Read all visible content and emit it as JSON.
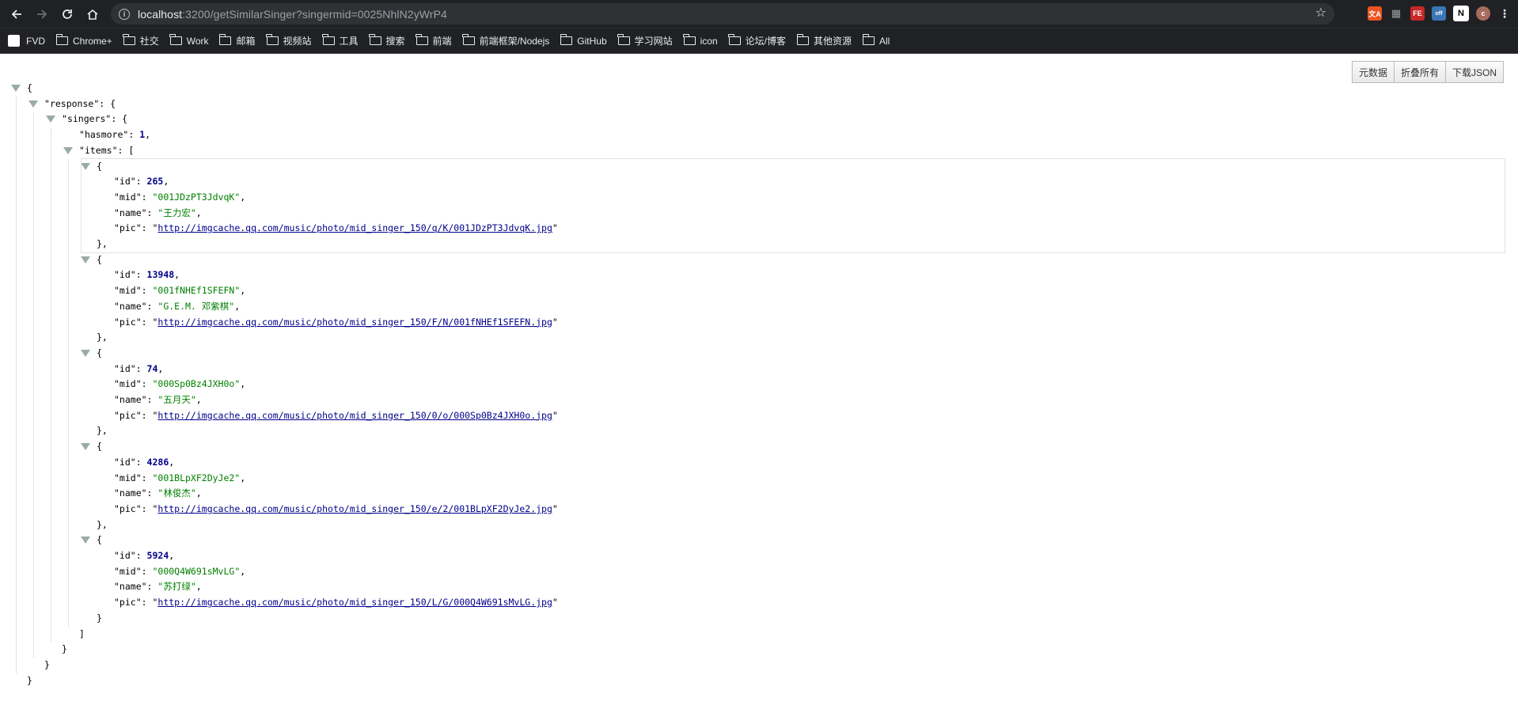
{
  "browser": {
    "url_host": "localhost",
    "url_rest": ":3200/getSimilarSinger?singermid=0025NhlN2yWrP4",
    "bookmarks": [
      "FVD",
      "Chrome+",
      "社交",
      "Work",
      "邮箱",
      "视频站",
      "工具",
      "搜索",
      "前端",
      "前端框架/Nodejs",
      "GitHub",
      "学习网站",
      "icon",
      "论坛/博客",
      "其他资源",
      "All"
    ],
    "avatar_letter": "c",
    "ext_python_badge": "off"
  },
  "toolbar": {
    "raw": "元数据",
    "collapse": "折叠所有",
    "download": "下载JSON"
  },
  "json": {
    "k_response": "response",
    "k_singers": "singers",
    "k_hasmore": "hasmore",
    "hasmore": "1",
    "k_items": "items",
    "items": [
      {
        "id": "265",
        "mid": "001JDzPT3JdvqK",
        "name": "王力宏",
        "pic": "http://imgcache.qq.com/music/photo/mid_singer_150/q/K/001JDzPT3JdvqK.jpg"
      },
      {
        "id": "13948",
        "mid": "001fNHEf1SFEFN",
        "name": "G.E.M. 邓紫棋",
        "pic": "http://imgcache.qq.com/music/photo/mid_singer_150/F/N/001fNHEf1SFEFN.jpg"
      },
      {
        "id": "74",
        "mid": "000Sp0Bz4JXH0o",
        "name": "五月天",
        "pic": "http://imgcache.qq.com/music/photo/mid_singer_150/0/o/000Sp0Bz4JXH0o.jpg"
      },
      {
        "id": "4286",
        "mid": "001BLpXF2DyJe2",
        "name": "林俊杰",
        "pic": "http://imgcache.qq.com/music/photo/mid_singer_150/e/2/001BLpXF2DyJe2.jpg"
      },
      {
        "id": "5924",
        "mid": "000Q4W691sMvLG",
        "name": "苏打绿",
        "pic": "http://imgcache.qq.com/music/photo/mid_singer_150/L/G/000Q4W691sMvLG.jpg"
      }
    ]
  }
}
